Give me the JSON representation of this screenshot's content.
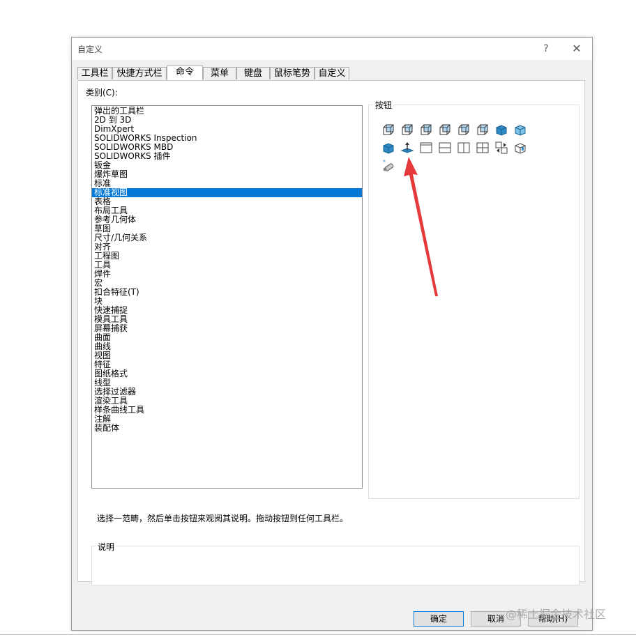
{
  "dialog": {
    "title": "自定义",
    "help_glyph": "?",
    "close_glyph": "✕"
  },
  "tabs": [
    {
      "label": "工具栏",
      "active": false
    },
    {
      "label": "快捷方式栏",
      "active": false
    },
    {
      "label": "命令",
      "active": true
    },
    {
      "label": "菜单",
      "active": false
    },
    {
      "label": "键盘",
      "active": false
    },
    {
      "label": "鼠标笔势",
      "active": false
    },
    {
      "label": "自定义",
      "active": false
    }
  ],
  "categories": {
    "label": "类别(C):",
    "items": [
      "弹出的工具栏",
      "2D 到 3D",
      "DimXpert",
      "SOLIDWORKS Inspection",
      "SOLIDWORKS MBD",
      "SOLIDWORKS 插件",
      "钣金",
      "爆炸草图",
      "标准",
      "标准视图",
      "表格",
      "布局工具",
      "参考几何体",
      "草图",
      "尺寸/几何关系",
      "对齐",
      "工程图",
      "工具",
      "焊件",
      "宏",
      "扣合特征(T)",
      "块",
      "快速捕捉",
      "模具工具",
      "屏幕捕获",
      "曲面",
      "曲线",
      "视图",
      "特征",
      "图纸格式",
      "线型",
      "选择过滤器",
      "渲染工具",
      "样条曲线工具",
      "注解",
      "装配体"
    ],
    "selected": "标准视图"
  },
  "buttons_group": {
    "label": "按钮",
    "icons": [
      "front-view-icon",
      "back-view-icon",
      "left-view-icon",
      "right-view-icon",
      "top-view-icon",
      "bottom-view-icon",
      "isometric-view-icon",
      "trimetric-view-icon",
      "dimetric-view-icon",
      "normal-to-icon",
      "single-view-icon",
      "two-view-horizontal-icon",
      "two-view-vertical-icon",
      "four-view-icon",
      "link-views-icon",
      "3d-view-icon",
      "new-view-icon"
    ],
    "accent": "#2e8bc7",
    "arrow_color": "#e5393b"
  },
  "hint_text": "选择一范畴，然后单击按钮来观阅其说明。拖动按钮到任何工具栏。",
  "description": {
    "label": "说明",
    "text": ""
  },
  "footer": {
    "ok_label": "确定",
    "cancel_label": "取消",
    "help_label": "帮助(H)"
  },
  "watermark": "@稀土掘金技术社区"
}
